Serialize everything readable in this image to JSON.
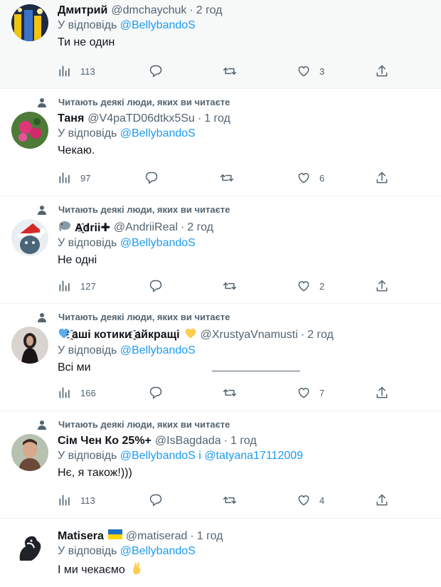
{
  "social_context": "Читають деякі люди, яких ви читаєте",
  "reply_prefix": "У відповідь",
  "tweets": [
    {
      "name": "Дмитрий",
      "handle": "@dmchaychuk",
      "time": "2 год",
      "reply_to": "@BellybandoS",
      "text": "Ти не один",
      "views": "113",
      "likes": "3"
    },
    {
      "name": "Таня",
      "handle": "@V4paTD06dtkx5Su",
      "time": "1 год",
      "reply_to": "@BellybandoS",
      "text": "Чекаю.",
      "views": "97",
      "likes": "6"
    },
    {
      "name": "A҈drii✚",
      "handle": "@AndriiReal",
      "time": "2 год",
      "reply_to": "@BellybandoS",
      "text": "Не одні",
      "views": "127",
      "likes": "2"
    },
    {
      "name": "҈аші котики ҈айкращі",
      "handle": "@XrustyaVnamusti",
      "time": "2 год",
      "reply_to": "@BellybandoS",
      "text": "Всі ми",
      "views": "166",
      "likes": "7"
    },
    {
      "name": "Сім Чен Ко 25%+",
      "handle": "@IsBagdada",
      "time": "1 год",
      "reply_to": "@BellybandoS",
      "reply_and": "і",
      "reply_to_2": "@tatyana17112009",
      "text": "Нє, я також!)))",
      "views": "113",
      "likes": "4"
    },
    {
      "name": "Matisera",
      "handle": "@matiserad",
      "time": "1 год",
      "reply_to": "@BellybandoS",
      "text": "І ми чекаємо"
    }
  ],
  "icons": [
    "views-icon",
    "reply-icon",
    "retweet-icon",
    "like-icon",
    "share-icon",
    "person-icon"
  ],
  "colors": {
    "link": "#1d9bf0",
    "muted": "#536471",
    "highlight_bg": "#f7f9f9"
  }
}
